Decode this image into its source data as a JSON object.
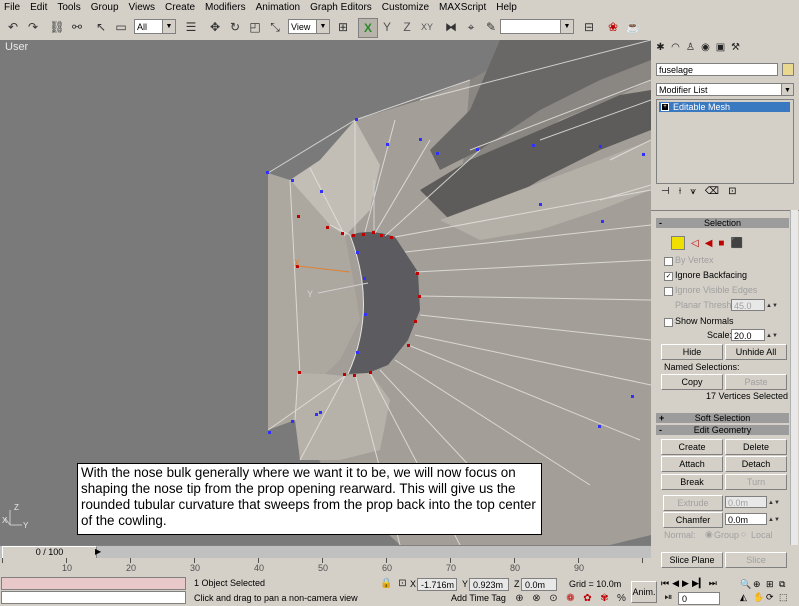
{
  "menu": [
    "File",
    "Edit",
    "Tools",
    "Group",
    "Views",
    "Create",
    "Modifiers",
    "Animation",
    "Graph Editors",
    "Customize",
    "MAXScript",
    "Help"
  ],
  "toolbar": {
    "selection_filter": "All",
    "reference_coord": "View",
    "axis_x": "X",
    "axis_y": "Y",
    "axis_z": "Z",
    "axis_xy": "XY"
  },
  "viewport": {
    "label": "User",
    "gizmo_x": "X",
    "gizmo_y": "Y",
    "axis_z": "Z",
    "axis_x": "X",
    "axis_y": "Y"
  },
  "caption": "With the nose bulk generally where we want it to be, we will now focus on shaping the nose tip from the prop opening rearward.  This will give us the rounded tubular curvature that sweeps from the prop back into the top center of the cowling.",
  "command_panel": {
    "object_name": "fuselage",
    "modifier_list": "Modifier List",
    "stack_item": "Editable Mesh",
    "selection": {
      "header": "Selection",
      "by_vertex": "By Vertex",
      "ignore_backfacing": "Ignore Backfacing",
      "ignore_visible_edges": "Ignore Visible Edges",
      "planar_thresh_label": "Planar Thresh",
      "planar_thresh_value": "45.0",
      "show_normals": "Show Normals",
      "scale_label": "Scale:",
      "scale_value": "20.0",
      "hide": "Hide",
      "unhide_all": "Unhide All",
      "named_selections": "Named Selections:",
      "copy": "Copy",
      "paste": "Paste",
      "status": "17 Vertices Selected"
    },
    "soft_selection": "Soft Selection",
    "edit_geometry": {
      "header": "Edit Geometry",
      "create": "Create",
      "delete": "Delete",
      "attach": "Attach",
      "detach": "Detach",
      "break": "Break",
      "turn": "Turn",
      "extrude": "Extrude",
      "extrude_value": "0.0m",
      "chamfer": "Chamfer",
      "chamfer_value": "0.0m",
      "normal": "Normal:",
      "group": "Group",
      "local": "Local",
      "slice_plane": "Slice Plane",
      "slice": "Slice"
    }
  },
  "timeline": {
    "slider": "0 / 100",
    "ticks": [
      "10",
      "20",
      "30",
      "40",
      "50",
      "60",
      "70",
      "80",
      "90"
    ]
  },
  "status": {
    "selected": "1 Object Selected",
    "prompt": "Click and drag to pan a non-camera view",
    "x_label": "X",
    "x_value": "-1.716m",
    "y_label": "Y",
    "y_value": "0.923m",
    "z_label": "Z",
    "z_value": "0.0m",
    "grid": "Grid = 10.0m",
    "add_time_tag": "Add Time Tag",
    "anim": "Anim.",
    "frame": "0"
  },
  "colors": {
    "ui_gray": "#d4d0c8",
    "viewport_bg": "#7c7c7c",
    "mesh_fill": "#a8a39b",
    "stack_highlight": "#3a78c0",
    "vertex_blue": "#3030ff",
    "vertex_red": "#c00000",
    "rollout_header": "#9c9c9c"
  }
}
